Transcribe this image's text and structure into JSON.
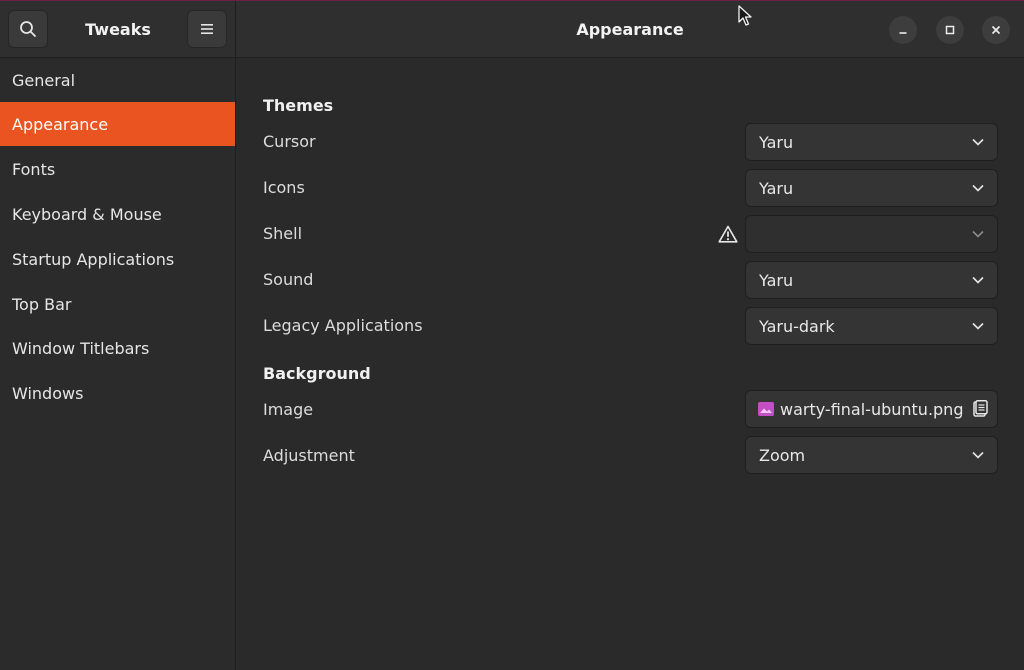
{
  "header": {
    "app_title": "Tweaks",
    "page_title": "Appearance"
  },
  "sidebar": {
    "items": [
      {
        "label": "General"
      },
      {
        "label": "Appearance",
        "active": true
      },
      {
        "label": "Fonts"
      },
      {
        "label": "Keyboard & Mouse"
      },
      {
        "label": "Startup Applications"
      },
      {
        "label": "Top Bar"
      },
      {
        "label": "Window Titlebars"
      },
      {
        "label": "Windows"
      }
    ]
  },
  "themes": {
    "title": "Themes",
    "cursor": {
      "label": "Cursor",
      "value": "Yaru"
    },
    "icons": {
      "label": "Icons",
      "value": "Yaru"
    },
    "shell": {
      "label": "Shell",
      "value": ""
    },
    "sound": {
      "label": "Sound",
      "value": "Yaru"
    },
    "legacy": {
      "label": "Legacy Applications",
      "value": "Yaru-dark"
    }
  },
  "background": {
    "title": "Background",
    "image": {
      "label": "Image",
      "value": "warty-final-ubuntu.png"
    },
    "adjustment": {
      "label": "Adjustment",
      "value": "Zoom"
    }
  },
  "colors": {
    "accent": "#e95420",
    "image_icon": "#c44fc4"
  }
}
